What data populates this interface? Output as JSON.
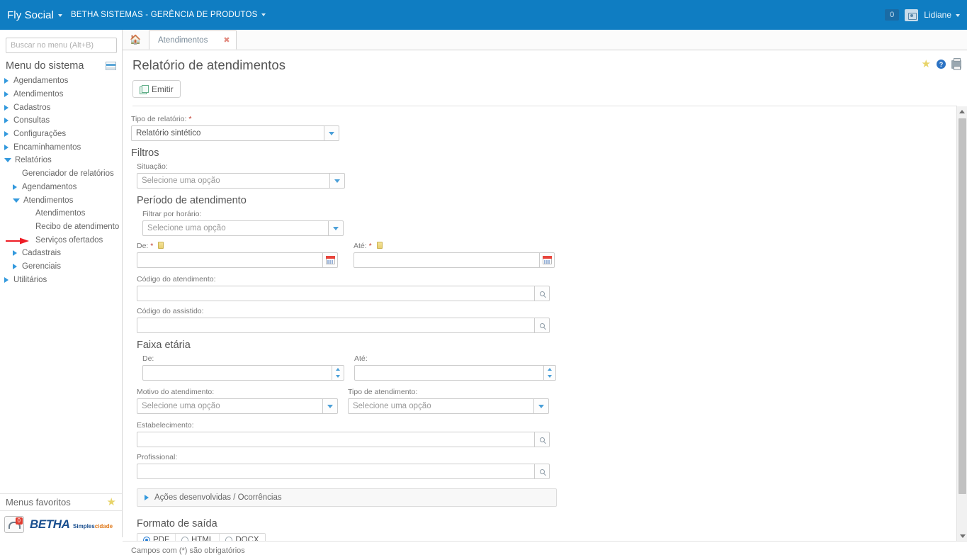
{
  "topbar": {
    "brand": "Fly Social",
    "org": "BETHA SISTEMAS - GERÊNCIA DE PRODUTOS",
    "notification_count": "0",
    "username": "Lidiane"
  },
  "sidebar": {
    "search_placeholder": "Buscar no menu (Alt+B)",
    "menu_title": "Menu do sistema",
    "items": [
      {
        "label": "Agendamentos",
        "level": 1,
        "state": "collapsed"
      },
      {
        "label": "Atendimentos",
        "level": 1,
        "state": "collapsed"
      },
      {
        "label": "Cadastros",
        "level": 1,
        "state": "collapsed"
      },
      {
        "label": "Consultas",
        "level": 1,
        "state": "collapsed"
      },
      {
        "label": "Configurações",
        "level": 1,
        "state": "collapsed"
      },
      {
        "label": "Encaminhamentos",
        "level": 1,
        "state": "collapsed"
      },
      {
        "label": "Relatórios",
        "level": 1,
        "state": "expanded"
      },
      {
        "label": "Gerenciador de relatórios",
        "level": 2,
        "state": "leaf"
      },
      {
        "label": "Agendamentos",
        "level": 2,
        "state": "collapsed"
      },
      {
        "label": "Atendimentos",
        "level": 2,
        "state": "expanded"
      },
      {
        "label": "Atendimentos",
        "level": 3,
        "state": "leaf"
      },
      {
        "label": "Recibo de atendimento",
        "level": 3,
        "state": "leaf"
      },
      {
        "label": "Serviços ofertados",
        "level": 3,
        "state": "leaf"
      },
      {
        "label": "Cadastrais",
        "level": 2,
        "state": "collapsed"
      },
      {
        "label": "Gerenciais",
        "level": 2,
        "state": "collapsed"
      },
      {
        "label": "Utilitários",
        "level": 1,
        "state": "collapsed"
      }
    ],
    "favorites_title": "Menus favoritos",
    "logo_primary": "BETHA",
    "logo_suffix_a": "Simples",
    "logo_suffix_b": "cidade",
    "support_badge": "0"
  },
  "tabs": {
    "home_icon": "home-icon",
    "active_tab": "Atendimentos"
  },
  "page": {
    "title": "Relatório de atendimentos",
    "emit_button": "Emitir"
  },
  "form": {
    "report_type": {
      "label": "Tipo de relatório:",
      "required": "*",
      "value": "Relatório sintético"
    },
    "filters_heading": "Filtros",
    "situation": {
      "label": "Situação:",
      "placeholder": "Selecione uma opção"
    },
    "period_heading": "Período de atendimento",
    "filter_by_time": {
      "label": "Filtrar por horário:",
      "placeholder": "Selecione uma opção"
    },
    "date_from": {
      "label": "De:",
      "required": "*",
      "value": ""
    },
    "date_to": {
      "label": "Até:",
      "required": "*",
      "value": ""
    },
    "service_code": {
      "label": "Código do atendimento:",
      "value": ""
    },
    "assisted_code": {
      "label": "Código do assistido:",
      "value": ""
    },
    "age_range_heading": "Faixa etária",
    "age_from": {
      "label": "De:",
      "value": ""
    },
    "age_to": {
      "label": "Até:",
      "value": ""
    },
    "service_reason": {
      "label": "Motivo do atendimento:",
      "placeholder": "Selecione uma opção"
    },
    "service_type": {
      "label": "Tipo de atendimento:",
      "placeholder": "Selecione uma opção"
    },
    "establishment": {
      "label": "Estabelecimento:",
      "value": ""
    },
    "professional": {
      "label": "Profissional:",
      "value": ""
    },
    "accordion_label": "Ações desenvolvidas / Ocorrências",
    "output_heading": "Formato de saída",
    "output_options": [
      {
        "label": "PDF",
        "selected": true
      },
      {
        "label": "HTML",
        "selected": false
      },
      {
        "label": "DOCX",
        "selected": false
      }
    ],
    "required_note": "Campos com (*) são obrigatórios"
  }
}
